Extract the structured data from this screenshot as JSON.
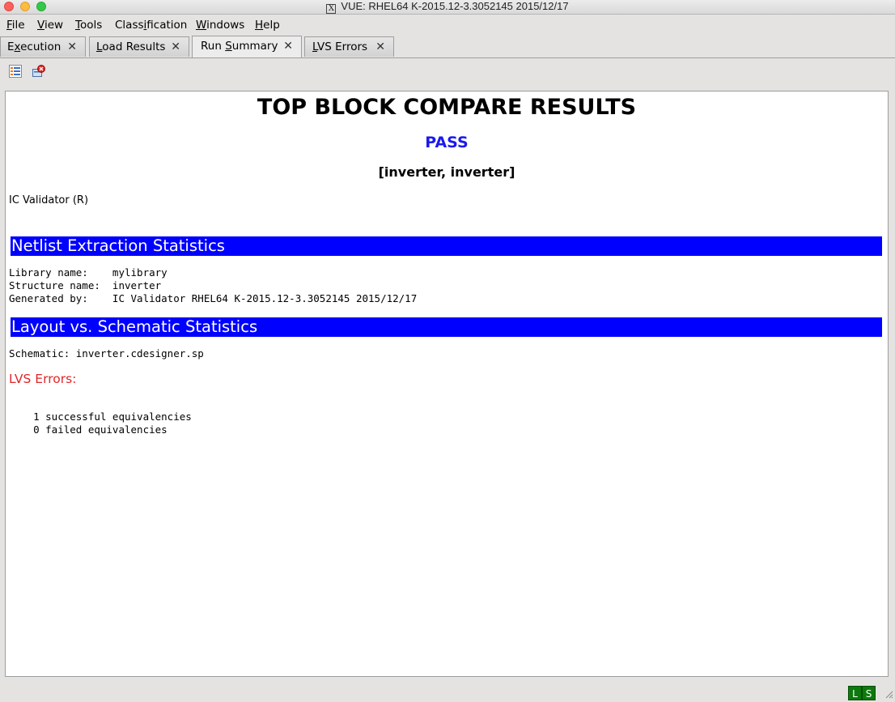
{
  "window": {
    "title": "VUE:  RHEL64 K-2015.12-3.3052145 2015/12/17",
    "x_icon": "X"
  },
  "menu": [
    {
      "mn": "F",
      "rest": "ile"
    },
    {
      "mn": "V",
      "rest": "iew"
    },
    {
      "mn": "T",
      "rest": "ools"
    },
    {
      "pre": "Class",
      "mn": "i",
      "rest": "fication"
    },
    {
      "mn": "W",
      "rest": "indows"
    },
    {
      "mn": "H",
      "rest": "elp"
    }
  ],
  "tabs": [
    {
      "pre": "E",
      "mn": "x",
      "rest": "ecution",
      "close": "✕"
    },
    {
      "pre": "",
      "mn": "L",
      "rest": "oad Results",
      "close": "✕"
    },
    {
      "pre": "Run ",
      "mn": "S",
      "rest": "ummary",
      "close": "✕"
    },
    {
      "pre": "",
      "mn": "L",
      "rest": "VS Errors",
      "close": "✕"
    }
  ],
  "toolbar": {
    "icons": [
      "list-view-icon",
      "clear-errors-icon"
    ]
  },
  "report": {
    "title": "TOP BLOCK COMPARE RESULTS",
    "result": "PASS",
    "pair": "[inverter, inverter]",
    "tool": "IC Validator (R)",
    "netlist_section": "Netlist Extraction Statistics",
    "netlist_lines": [
      "Library name:    mylibrary",
      "Structure name:  inverter",
      "Generated by:    IC Validator RHEL64 K-2015.12-3.3052145 2015/12/17"
    ],
    "lvs_section": "Layout vs. Schematic Statistics",
    "schematic_line": "Schematic: inverter.cdesigner.sp",
    "lvs_errors_label": "LVS Errors:",
    "equiv_lines": [
      "    1 successful equivalencies",
      "    0 failed equivalencies"
    ]
  },
  "status": {
    "l": "L",
    "s": "S",
    "color": "#0c7a0c"
  }
}
